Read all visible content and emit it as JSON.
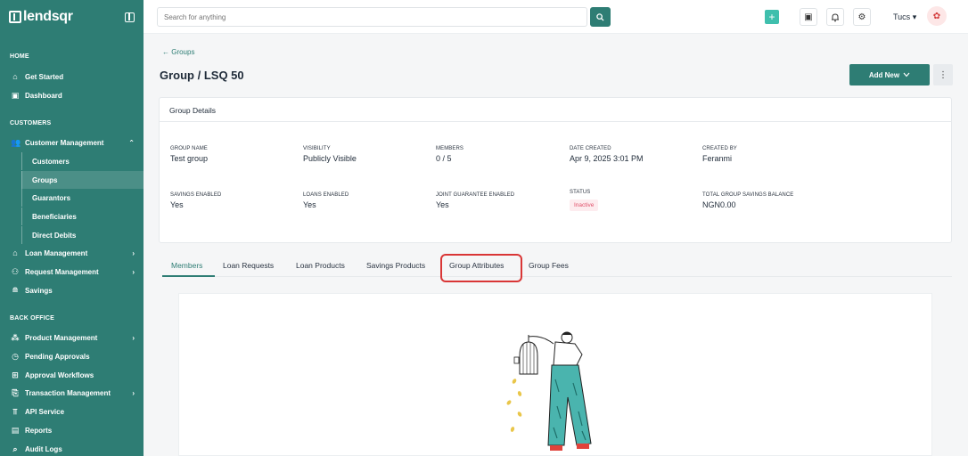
{
  "app": {
    "brand": "lendsqr"
  },
  "topbar": {
    "search_placeholder": "Search for anything",
    "user_name": "Tucs",
    "icons": [
      "search-icon",
      "plus-icon",
      "book-icon",
      "bell-icon",
      "gear-icon"
    ]
  },
  "sidebar": {
    "sections": {
      "home": "HOME",
      "customers": "CUSTOMERS",
      "back_office": "BACK OFFICE"
    },
    "items": {
      "get_started": "Get Started",
      "dashboard": "Dashboard",
      "customer_management": "Customer Management",
      "customers": "Customers",
      "groups": "Groups",
      "guarantors": "Guarantors",
      "beneficiaries": "Beneficiaries",
      "direct_debits": "Direct Debits",
      "loan_management": "Loan Management",
      "request_management": "Request Management",
      "savings": "Savings",
      "product_management": "Product Management",
      "pending_approvals": "Pending Approvals",
      "approval_workflows": "Approval Workflows",
      "transaction_management": "Transaction Management",
      "api_service": "API Service",
      "reports": "Reports",
      "audit_logs": "Audit Logs"
    }
  },
  "header": {
    "back_link": "← Groups",
    "title": "Group / LSQ 50",
    "add_new": "Add New",
    "more": "⋮"
  },
  "details": {
    "heading": "Group Details",
    "group_name_label": "GROUP NAME",
    "group_name": "Test group",
    "visibility_label": "VISIBILITY",
    "visibility": "Publicly Visible",
    "members_label": "MEMBERS",
    "members": "0 / 5",
    "date_created_label": "DATE CREATED",
    "date_created": "Apr 9, 2025 3:01 PM",
    "created_by_label": "CREATED BY",
    "created_by": "Feranmi",
    "savings_enabled_label": "SAVINGS ENABLED",
    "savings_enabled": "Yes",
    "loans_enabled_label": "LOANS ENABLED",
    "loans_enabled": "Yes",
    "joint_guarantee_label": "JOINT GUARANTEE ENABLED",
    "joint_guarantee": "Yes",
    "status_label": "STATUS",
    "status": "Inactive",
    "total_savings_label": "TOTAL GROUP SAVINGS BALANCE",
    "total_savings": "NGN0.00"
  },
  "tabs": {
    "members": "Members",
    "loan_requests": "Loan Requests",
    "loan_products": "Loan Products",
    "savings_products": "Savings Products",
    "group_attributes": "Group Attributes",
    "group_fees": "Group Fees"
  },
  "colors": {
    "brand": "#2e7d74",
    "highlight": "#d93636",
    "inactive": "#e0506a"
  }
}
